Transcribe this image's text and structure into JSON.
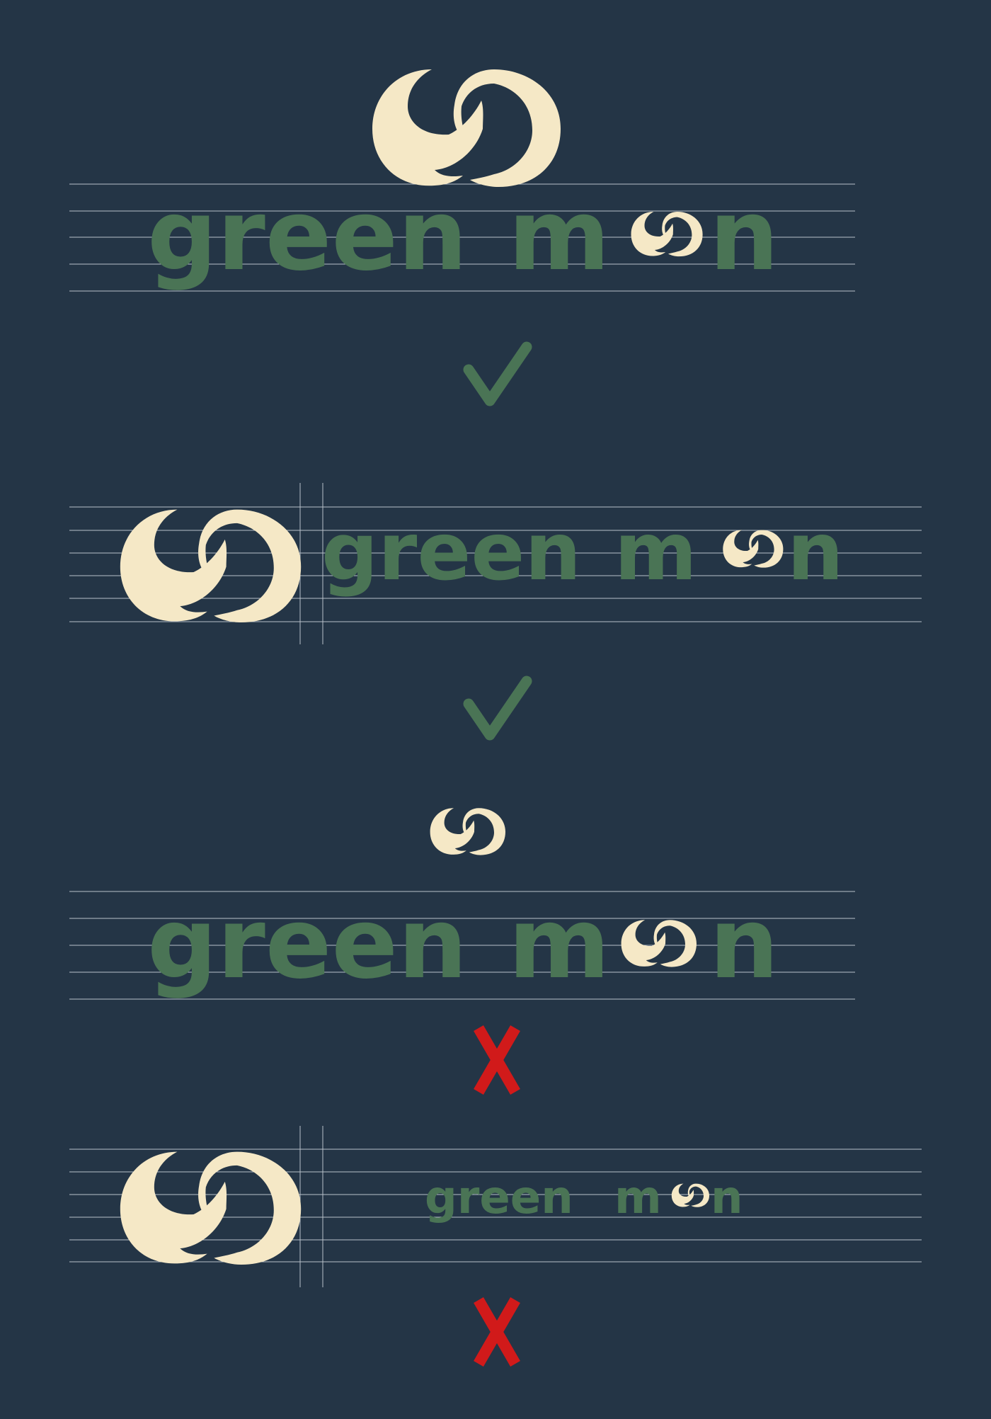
{
  "brand": {
    "word_green": "green",
    "word_m": "m",
    "word_n": "n"
  },
  "marks": {
    "correct": "✓",
    "incorrect": "X"
  },
  "colors": {
    "background": "#243546",
    "wordmark_green": "#4A7455",
    "moon_cream": "#F5E8C6",
    "guide_line": "#B9C1CA",
    "check_green": "#4A7455",
    "cross_red": "#D11A1A"
  },
  "sections": [
    {
      "id": "stacked-logo-correct",
      "verdict": "correct"
    },
    {
      "id": "horizontal-logo-correct",
      "verdict": "correct"
    },
    {
      "id": "stacked-logo-small-emblem",
      "verdict": "incorrect"
    },
    {
      "id": "horizontal-logo-small-text",
      "verdict": "incorrect"
    }
  ]
}
